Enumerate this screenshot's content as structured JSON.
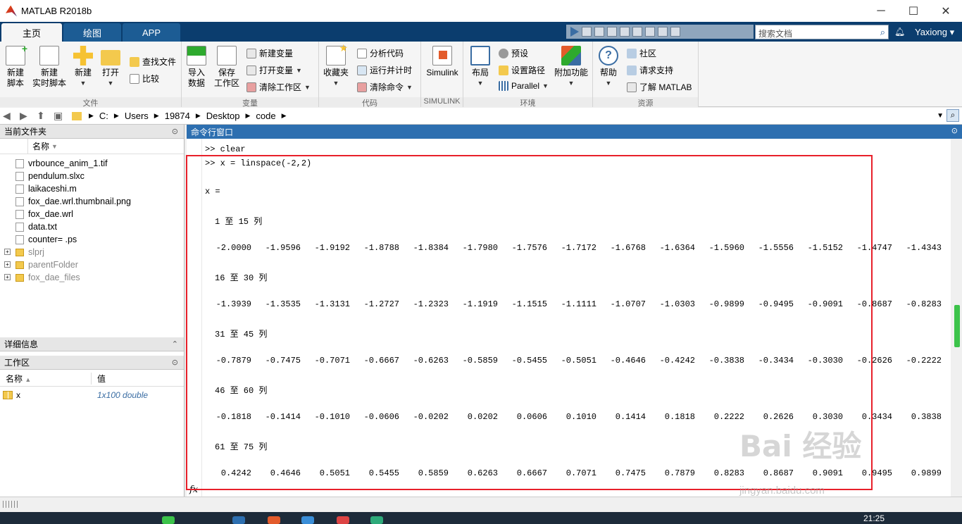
{
  "window": {
    "title": "MATLAB R2018b",
    "min": "─",
    "max": "☐",
    "close": "✕"
  },
  "tabs": [
    "主页",
    "绘图",
    "APP"
  ],
  "search": {
    "placeholder": "搜索文档"
  },
  "user": "Yaxiong ▾",
  "ribbon": {
    "file": {
      "label": "文件",
      "new_script": "新建\n脚本",
      "new_live": "新建\n实时脚本",
      "new": "新建",
      "open": "打开",
      "find": "查找文件",
      "compare": "比较"
    },
    "variable": {
      "label": "变量",
      "import": "导入\n数据",
      "save": "保存\n工作区",
      "new_var": "新建变量",
      "open_var": "打开变量",
      "clear_ws": "清除工作区"
    },
    "code": {
      "label": "代码",
      "favorites": "收藏夹",
      "analyze": "分析代码",
      "run_time": "运行并计时",
      "clear_cmd": "清除命令"
    },
    "simulink": {
      "label": "SIMULINK",
      "btn": "Simulink"
    },
    "env": {
      "label": "环境",
      "layout": "布局",
      "prefs": "预设",
      "set_path": "设置路径",
      "parallel": "Parallel",
      "addons": "附加功能"
    },
    "resources": {
      "label": "资源",
      "help": "帮助",
      "community": "社区",
      "support": "请求支持",
      "learn": "了解 MATLAB"
    }
  },
  "address": [
    "C:",
    "Users",
    "19874",
    "Desktop",
    "code"
  ],
  "current_folder": {
    "title": "当前文件夹",
    "col_name": "名称",
    "files": [
      {
        "name": "vrbounce_anim_1.tif",
        "type": "file"
      },
      {
        "name": "pendulum.slxc",
        "type": "file"
      },
      {
        "name": "laikaceshi.m",
        "type": "file"
      },
      {
        "name": "fox_dae.wrl.thumbnail.png",
        "type": "file"
      },
      {
        "name": "fox_dae.wrl",
        "type": "file"
      },
      {
        "name": "data.txt",
        "type": "file"
      },
      {
        "name": "counter= .ps",
        "type": "file"
      },
      {
        "name": "slprj",
        "type": "dir"
      },
      {
        "name": "parentFolder",
        "type": "dir"
      },
      {
        "name": "fox_dae_files",
        "type": "dir"
      }
    ]
  },
  "details": {
    "title": "详细信息"
  },
  "workspace": {
    "title": "工作区",
    "col_name": "名称",
    "col_value": "值",
    "var_name": "x",
    "var_value": "1x100 double"
  },
  "command_window": {
    "title": "命令行窗口",
    "lines": [
      ">> clear",
      ">> x = linspace(-2,2)",
      "x ="
    ],
    "blocks": [
      {
        "header": "1 至 15 列",
        "values": [
          "-2.0000",
          "-1.9596",
          "-1.9192",
          "-1.8788",
          "-1.8384",
          "-1.7980",
          "-1.7576",
          "-1.7172",
          "-1.6768",
          "-1.6364",
          "-1.5960",
          "-1.5556",
          "-1.5152",
          "-1.4747",
          "-1.4343"
        ]
      },
      {
        "header": "16 至 30 列",
        "values": [
          "-1.3939",
          "-1.3535",
          "-1.3131",
          "-1.2727",
          "-1.2323",
          "-1.1919",
          "-1.1515",
          "-1.1111",
          "-1.0707",
          "-1.0303",
          "-0.9899",
          "-0.9495",
          "-0.9091",
          "-0.8687",
          "-0.8283"
        ]
      },
      {
        "header": "31 至 45 列",
        "values": [
          "-0.7879",
          "-0.7475",
          "-0.7071",
          "-0.6667",
          "-0.6263",
          "-0.5859",
          "-0.5455",
          "-0.5051",
          "-0.4646",
          "-0.4242",
          "-0.3838",
          "-0.3434",
          "-0.3030",
          "-0.2626",
          "-0.2222"
        ]
      },
      {
        "header": "46 至 60 列",
        "values": [
          "-0.1818",
          "-0.1414",
          "-0.1010",
          "-0.0606",
          "-0.0202",
          "0.0202",
          "0.0606",
          "0.1010",
          "0.1414",
          "0.1818",
          "0.2222",
          "0.2626",
          "0.3030",
          "0.3434",
          "0.3838"
        ]
      },
      {
        "header": "61 至 75 列",
        "values": [
          "0.4242",
          "0.4646",
          "0.5051",
          "0.5455",
          "0.5859",
          "0.6263",
          "0.6667",
          "0.7071",
          "0.7475",
          "0.7879",
          "0.8283",
          "0.8687",
          "0.9091",
          "0.9495",
          "0.9899"
        ]
      }
    ],
    "prompt_icon": "fx"
  },
  "watermark": {
    "main": "Bai 经验",
    "sub": "jingyan.baidu.com"
  },
  "clock": "21:25",
  "colors": {
    "tab_bar": "#0b3d6e",
    "cmd_header": "#2d6fb0",
    "highlight": "#e8202a"
  }
}
